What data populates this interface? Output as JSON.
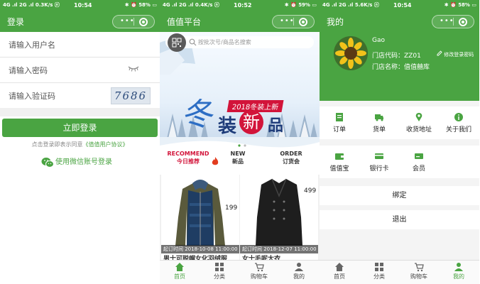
{
  "status_left": {
    "s1": "4G .ıl 2G .ıl 0.3K/s ⓝ",
    "s2": "4G .ıl 2G .ıl 0.4K/s ⓝ",
    "s3": "4G .ıl 2G .ıl 5.6K/s ⓝ"
  },
  "status_time": {
    "s1": "10:54",
    "s2": "10:52",
    "s3": "10:54"
  },
  "status_right": "✱ ⏰ 59% ▭",
  "status_right_s1": "✱ ⏰ 58% ▭",
  "status_right_s3": "✱ ⏰ 58% ▭",
  "login": {
    "title": "登录",
    "username_placeholder": "请输入用户名",
    "password_placeholder": "请输入密码",
    "captcha_placeholder": "请输入验证码",
    "captcha_code": "7686",
    "submit_label": "立即登录",
    "agreement_prefix": "点击登录即表示同意",
    "agreement_link": "《值值用户协议》",
    "wechat_login": "使用微信账号登录"
  },
  "home": {
    "title": "值值平台",
    "search_placeholder": "按批次号/商品名搜索",
    "banner_year": "2018冬装上新",
    "banner_big1": "冬",
    "banner_big2": "装",
    "banner_big3": "新",
    "banner_big4": "品",
    "categories": [
      {
        "en": "RECOMMEND",
        "cn": "今日推荐"
      },
      {
        "en": "NEW",
        "cn": "新品"
      },
      {
        "en": "ORDER",
        "cn": "订货会"
      }
    ],
    "products": [
      {
        "price": "199",
        "time": "起订时间 2018-10-08 11:00:00",
        "name": "男士可脱帽女化羽绒服"
      },
      {
        "price": "499",
        "time": "起订时间 2018-12-07 11:00:00",
        "name": "女士毛呢大衣"
      }
    ]
  },
  "tabs": [
    "首页",
    "分类",
    "购物车",
    "我的"
  ],
  "me": {
    "title": "我的",
    "name": "Gao",
    "store_code_label": "门店代码：",
    "store_code": "ZZ01",
    "store_name_label": "门店名称：",
    "store_name": "值值囍库",
    "edit_password": "修改登录密码",
    "grid1": [
      "订单",
      "货单",
      "收货地址",
      "关于我们"
    ],
    "grid2": [
      "值值宝",
      "银行卡",
      "会员"
    ],
    "bind": "绑定",
    "logout": "退出"
  },
  "colors": {
    "brand": "#4aa442",
    "accent_red": "#d2143a"
  }
}
